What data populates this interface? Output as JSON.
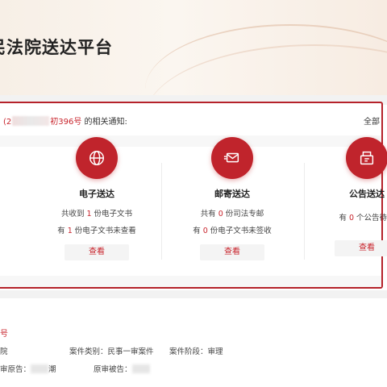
{
  "header": {
    "title": "民法院送达平台"
  },
  "notice": {
    "prefix": "(2",
    "case_suffix": "初396号",
    "tail": " 的相关通知:",
    "all_link": "全部"
  },
  "cards": [
    {
      "title": "电子送达",
      "icon": "globe-icon",
      "line1": {
        "pre": "共收到",
        "num": "1",
        "post": "份电子文书"
      },
      "line2": {
        "pre": "有",
        "num": "1",
        "post": "份电子文书未查看"
      },
      "button": "查看"
    },
    {
      "title": "邮寄送达",
      "icon": "mail-icon",
      "line1": {
        "pre": "共有",
        "num": "0",
        "post": "份司法专邮"
      },
      "line2": {
        "pre": "有",
        "num": "0",
        "post": "份电子文书未签收"
      },
      "button": "查看"
    },
    {
      "title": "公告送达",
      "icon": "announcement-icon",
      "line1": {
        "pre": "有",
        "num": "0",
        "post": "个公告待侵"
      },
      "button": "查看"
    }
  ],
  "case_info": {
    "case_no_label": "号",
    "court_suffix": "院",
    "case_category": "案件类别：民事一审案件",
    "case_stage": "案件阶段：审理",
    "plaintiff_label": "审原告：",
    "plaintiff_suffix": "潮",
    "defendant_label": "原审被告："
  },
  "colors": {
    "accent": "#c0242c",
    "border": "#b5222a"
  }
}
